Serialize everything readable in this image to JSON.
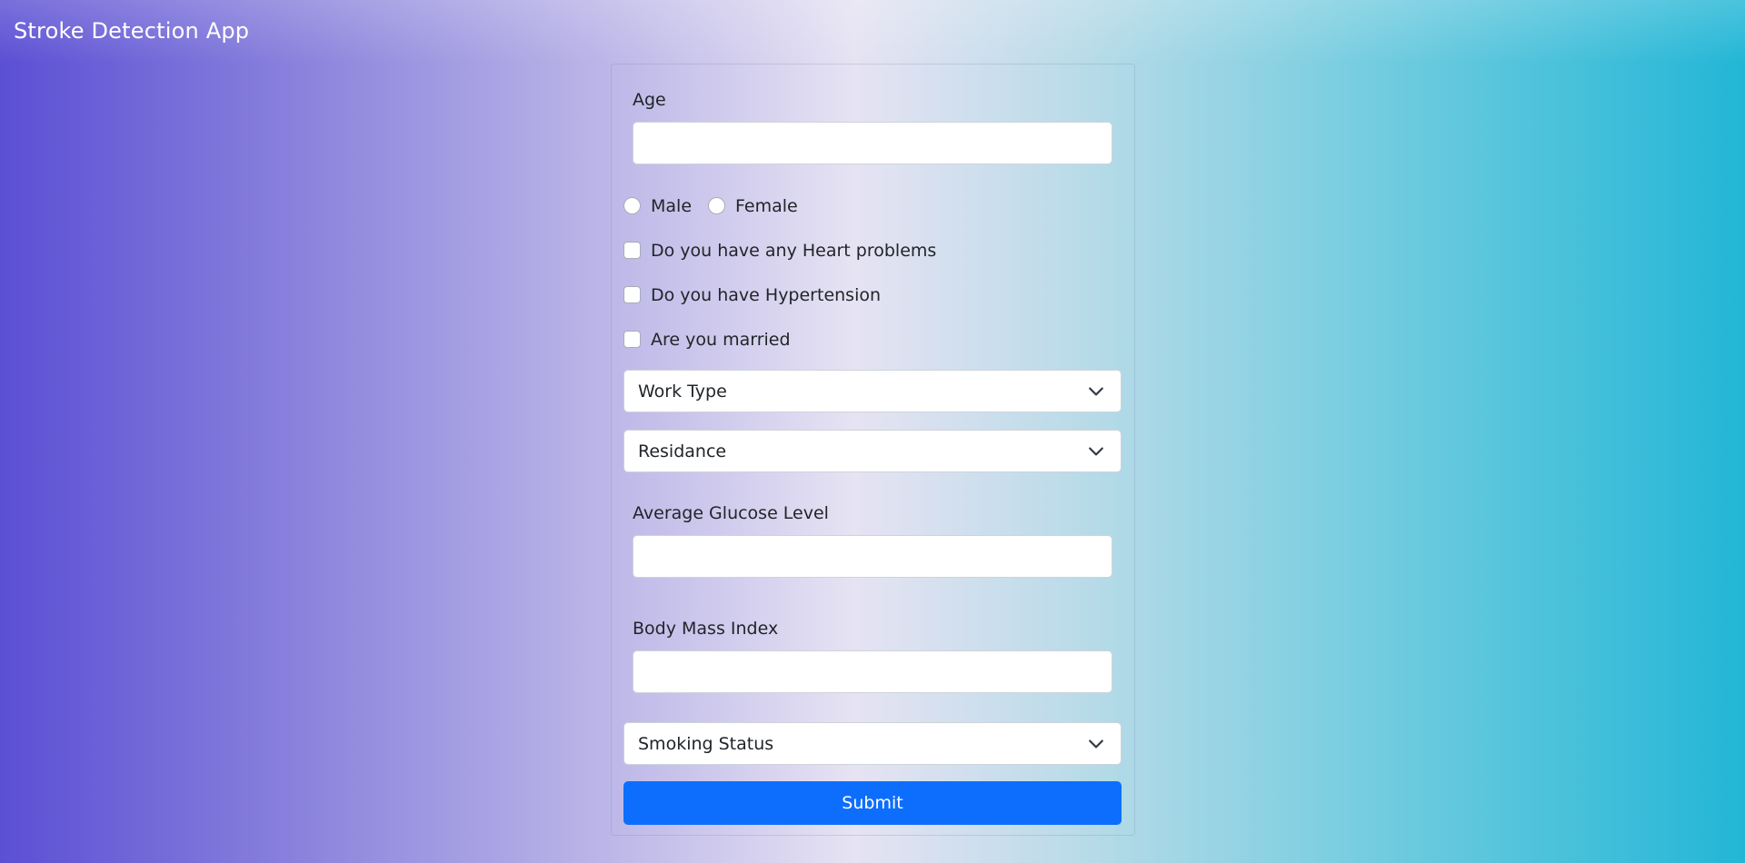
{
  "app": {
    "title": "Stroke Detection App"
  },
  "form": {
    "age": {
      "label": "Age",
      "value": ""
    },
    "gender": {
      "options": [
        "Male",
        "Female"
      ]
    },
    "heart_problems": {
      "label": "Do you have any Heart problems"
    },
    "hypertension": {
      "label": "Do you have Hypertension"
    },
    "married": {
      "label": "Are you married"
    },
    "work_type": {
      "selected": "Work Type"
    },
    "residence": {
      "selected": "Residance"
    },
    "glucose": {
      "label": "Average Glucose Level",
      "value": ""
    },
    "bmi": {
      "label": "Body Mass Index",
      "value": ""
    },
    "smoking": {
      "selected": "Smoking Status"
    },
    "submit_label": "Submit"
  },
  "colors": {
    "accent": "#0d6efd",
    "gradient_left": "#5b4fd4",
    "gradient_right": "#22b6d6"
  },
  "icons": {
    "select_arrow": "chevron-down-icon"
  }
}
